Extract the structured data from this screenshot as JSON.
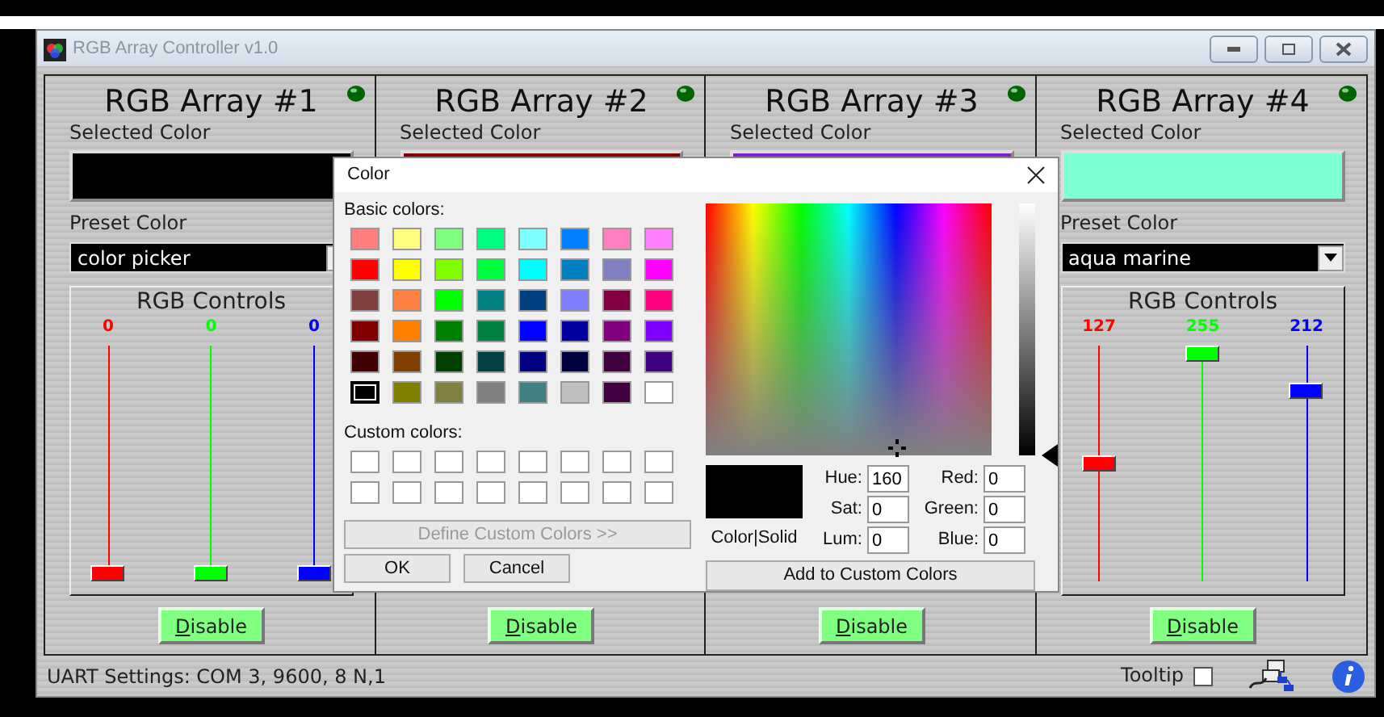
{
  "window": {
    "title": "RGB Array Controller v1.0"
  },
  "arrays": [
    {
      "title": "RGB Array #1",
      "selected_color_label": "Selected Color",
      "swatch": {
        "color": "#000000"
      },
      "preset_label": "Preset Color",
      "preset_value": "color picker",
      "controls_title": "RGB Controls",
      "channels": [
        {
          "value": "0",
          "level": 0,
          "color": "#ff0000"
        },
        {
          "value": "0",
          "level": 0,
          "color": "#00ff00"
        },
        {
          "value": "0",
          "level": 0,
          "color": "#0000ff"
        }
      ],
      "disable_button": "Disable"
    },
    {
      "title": "RGB Array #2",
      "selected_color_label": "Selected Color",
      "swatch": {
        "color": "#800000"
      },
      "disable_button": "Disable"
    },
    {
      "title": "RGB Array #3",
      "selected_color_label": "Selected Color",
      "swatch": {
        "color": "#7f22cc"
      },
      "disable_button": "Disable"
    },
    {
      "title": "RGB Array #4",
      "selected_color_label": "Selected Color",
      "swatch": {
        "color": "#7fffd4"
      },
      "preset_label": "Preset Color",
      "preset_value": "aqua marine",
      "controls_title": "RGB Controls",
      "channels": [
        {
          "value": "127",
          "level": 0.498,
          "color": "#ff0000"
        },
        {
          "value": "255",
          "level": 1,
          "color": "#00ff00"
        },
        {
          "value": "212",
          "level": 0.831,
          "color": "#0000ff"
        }
      ],
      "disable_button": "Disable"
    }
  ],
  "status_bar": {
    "text": "UART Settings: COM 3, 9600, 8 N,1",
    "tooltip_label": "Tooltip",
    "tooltip_checked": false
  },
  "color_dialog": {
    "title": "Color",
    "basic_label": "Basic colors:",
    "basic_colors": [
      {
        "color": "#ff8080",
        "selected": false
      },
      {
        "color": "#ffff80",
        "selected": false
      },
      {
        "color": "#80ff80",
        "selected": false
      },
      {
        "color": "#00ff80",
        "selected": false
      },
      {
        "color": "#80ffff",
        "selected": false
      },
      {
        "color": "#0080ff",
        "selected": false
      },
      {
        "color": "#ff80c0",
        "selected": false
      },
      {
        "color": "#ff80ff",
        "selected": false
      },
      {
        "color": "#ff0000",
        "selected": false
      },
      {
        "color": "#ffff00",
        "selected": false
      },
      {
        "color": "#80ff00",
        "selected": false
      },
      {
        "color": "#00ff40",
        "selected": false
      },
      {
        "color": "#00ffff",
        "selected": false
      },
      {
        "color": "#0080c0",
        "selected": false
      },
      {
        "color": "#8080c0",
        "selected": false
      },
      {
        "color": "#ff00ff",
        "selected": false
      },
      {
        "color": "#804040",
        "selected": false
      },
      {
        "color": "#ff8040",
        "selected": false
      },
      {
        "color": "#00ff00",
        "selected": false
      },
      {
        "color": "#008080",
        "selected": false
      },
      {
        "color": "#004080",
        "selected": false
      },
      {
        "color": "#8080ff",
        "selected": false
      },
      {
        "color": "#800040",
        "selected": false
      },
      {
        "color": "#ff0080",
        "selected": false
      },
      {
        "color": "#800000",
        "selected": false
      },
      {
        "color": "#ff8000",
        "selected": false
      },
      {
        "color": "#008000",
        "selected": false
      },
      {
        "color": "#008040",
        "selected": false
      },
      {
        "color": "#0000ff",
        "selected": false
      },
      {
        "color": "#0000a0",
        "selected": false
      },
      {
        "color": "#800080",
        "selected": false
      },
      {
        "color": "#8000ff",
        "selected": false
      },
      {
        "color": "#400000",
        "selected": false
      },
      {
        "color": "#804000",
        "selected": false
      },
      {
        "color": "#004000",
        "selected": false
      },
      {
        "color": "#004040",
        "selected": false
      },
      {
        "color": "#000080",
        "selected": false
      },
      {
        "color": "#000040",
        "selected": false
      },
      {
        "color": "#400040",
        "selected": false
      },
      {
        "color": "#400080",
        "selected": false
      },
      {
        "color": "#000000",
        "selected": true
      },
      {
        "color": "#808000",
        "selected": false
      },
      {
        "color": "#808040",
        "selected": false
      },
      {
        "color": "#808080",
        "selected": false
      },
      {
        "color": "#408080",
        "selected": false
      },
      {
        "color": "#c0c0c0",
        "selected": false
      },
      {
        "color": "#400040",
        "selected": false
      },
      {
        "color": "#ffffff",
        "selected": false
      }
    ],
    "custom_label": "Custom colors:",
    "custom_colors": [
      {
        "color": "#ffffff"
      },
      {
        "color": "#ffffff"
      },
      {
        "color": "#ffffff"
      },
      {
        "color": "#ffffff"
      },
      {
        "color": "#ffffff"
      },
      {
        "color": "#ffffff"
      },
      {
        "color": "#ffffff"
      },
      {
        "color": "#ffffff"
      },
      {
        "color": "#ffffff"
      },
      {
        "color": "#ffffff"
      },
      {
        "color": "#ffffff"
      },
      {
        "color": "#ffffff"
      },
      {
        "color": "#ffffff"
      },
      {
        "color": "#ffffff"
      },
      {
        "color": "#ffffff"
      },
      {
        "color": "#ffffff"
      }
    ],
    "define_button": {
      "label": "Define Custom Colors >>",
      "disabled": true
    },
    "ok_button": "OK",
    "cancel_button": "Cancel",
    "luminosity": {
      "level": 0
    },
    "preview": {
      "color": "#000000"
    },
    "preview_label": "Color|Solid",
    "fields": [
      {
        "label": "Hue:",
        "value": "160"
      },
      {
        "label": "Red:",
        "value": "0"
      },
      {
        "label": "Sat:",
        "value": "0"
      },
      {
        "label": "Green:",
        "value": "0"
      },
      {
        "label": "Lum:",
        "value": "0"
      },
      {
        "label": "Blue:",
        "value": "0"
      }
    ],
    "add_button": "Add to Custom Colors"
  }
}
